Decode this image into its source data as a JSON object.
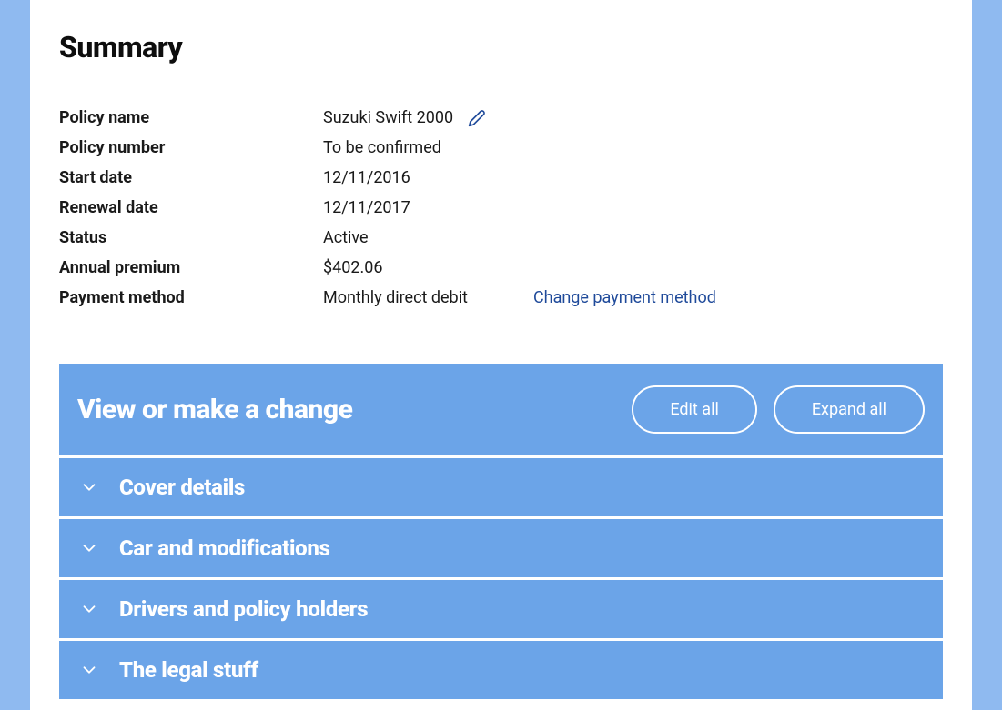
{
  "summary": {
    "title": "Summary",
    "rows": {
      "policyName": {
        "label": "Policy name",
        "value": "Suzuki Swift 2000"
      },
      "policyNumber": {
        "label": "Policy number",
        "value": "To be confirmed"
      },
      "startDate": {
        "label": "Start date",
        "value": "12/11/2016"
      },
      "renewalDate": {
        "label": "Renewal date",
        "value": "12/11/2017"
      },
      "status": {
        "label": "Status",
        "value": "Active"
      },
      "annualPremium": {
        "label": "Annual premium",
        "value": "$402.06"
      },
      "paymentMethod": {
        "label": "Payment method",
        "value": "Monthly direct debit",
        "link": "Change payment method"
      }
    }
  },
  "changes": {
    "title": "View or make a change",
    "editAll": "Edit all",
    "expandAll": "Expand all",
    "items": [
      "Cover details",
      "Car and modifications",
      "Drivers and policy holders",
      "The legal stuff"
    ]
  }
}
